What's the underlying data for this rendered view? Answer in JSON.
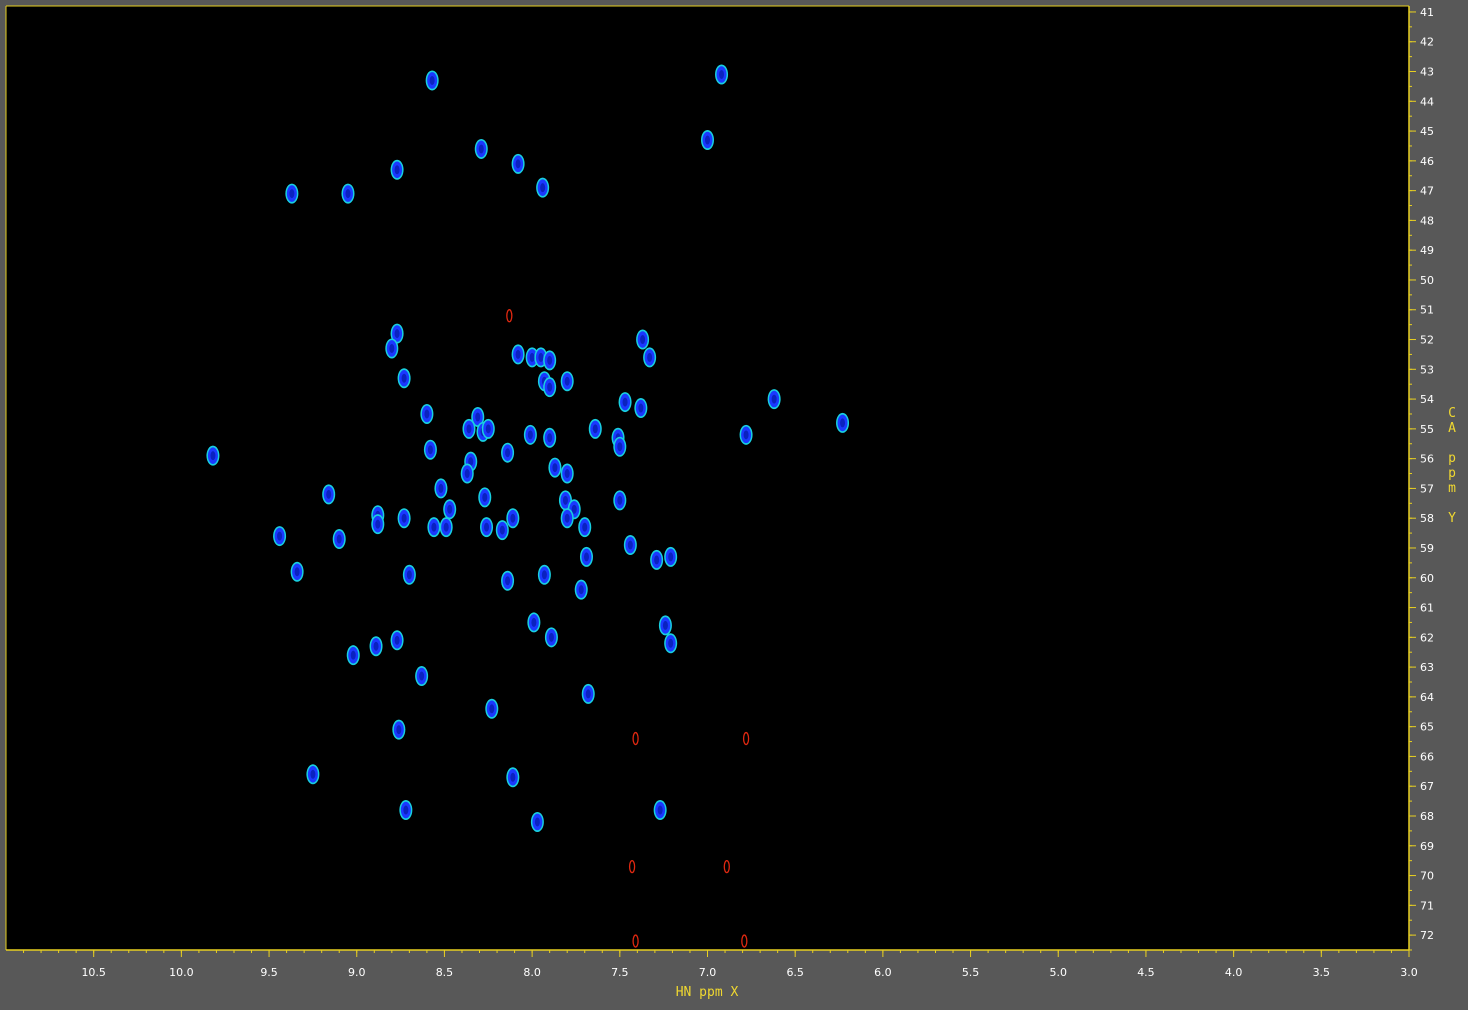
{
  "chart_data": {
    "type": "scatter",
    "subtype": "2D NMR HN-CA correlation spectrum (contour peaks)",
    "xlabel": "HN ppm X",
    "ylabel": "CA ppm Y",
    "x_axis_reversed": true,
    "xlim": [
      11.0,
      3.0
    ],
    "ylim": [
      40.8,
      72.5
    ],
    "x_ticks": [
      10.5,
      10.0,
      9.5,
      9.0,
      8.5,
      8.0,
      7.5,
      7.0,
      6.5,
      6.0,
      5.5,
      5.0,
      4.5,
      4.0,
      3.5,
      3.0
    ],
    "y_ticks": [
      41,
      42,
      43,
      44,
      45,
      46,
      47,
      48,
      49,
      50,
      51,
      52,
      53,
      54,
      55,
      56,
      57,
      58,
      59,
      60,
      61,
      62,
      63,
      64,
      65,
      66,
      67,
      68,
      69,
      70,
      71,
      72
    ],
    "grid": false,
    "colors": {
      "background": "#000000",
      "frame": "#585858",
      "axis": "#e8d020",
      "tick_label": "#ffffff",
      "positive_peak": "#1a38ff",
      "positive_peak_edge": "#18d0e0",
      "negative_peak": "#e02810"
    },
    "series": [
      {
        "sign": "positive",
        "points": [
          [
            8.57,
            43.3
          ],
          [
            6.92,
            43.1
          ],
          [
            8.29,
            45.6
          ],
          [
            7.0,
            45.3
          ],
          [
            8.08,
            46.1
          ],
          [
            8.77,
            46.3
          ],
          [
            7.94,
            46.9
          ],
          [
            9.37,
            47.1
          ],
          [
            9.05,
            47.1
          ],
          [
            8.77,
            51.8
          ],
          [
            7.37,
            52.0
          ],
          [
            8.8,
            52.3
          ],
          [
            8.08,
            52.5
          ],
          [
            8.0,
            52.6
          ],
          [
            7.95,
            52.6
          ],
          [
            7.9,
            52.7
          ],
          [
            7.33,
            52.6
          ],
          [
            8.73,
            53.3
          ],
          [
            7.8,
            53.4
          ],
          [
            7.93,
            53.4
          ],
          [
            7.9,
            53.6
          ],
          [
            6.62,
            54.0
          ],
          [
            7.47,
            54.1
          ],
          [
            7.38,
            54.3
          ],
          [
            8.6,
            54.5
          ],
          [
            6.23,
            54.8
          ],
          [
            8.31,
            54.6
          ],
          [
            8.36,
            55.0
          ],
          [
            8.28,
            55.1
          ],
          [
            8.25,
            55.0
          ],
          [
            7.64,
            55.0
          ],
          [
            6.78,
            55.2
          ],
          [
            8.01,
            55.2
          ],
          [
            7.9,
            55.3
          ],
          [
            7.51,
            55.3
          ],
          [
            7.5,
            55.6
          ],
          [
            9.82,
            55.9
          ],
          [
            8.58,
            55.7
          ],
          [
            8.14,
            55.8
          ],
          [
            8.35,
            56.1
          ],
          [
            8.37,
            56.5
          ],
          [
            7.87,
            56.3
          ],
          [
            7.8,
            56.5
          ],
          [
            7.5,
            57.4
          ],
          [
            8.52,
            57.0
          ],
          [
            9.16,
            57.2
          ],
          [
            8.27,
            57.3
          ],
          [
            7.81,
            57.4
          ],
          [
            8.47,
            57.7
          ],
          [
            7.76,
            57.7
          ],
          [
            7.8,
            58.0
          ],
          [
            8.88,
            57.9
          ],
          [
            8.73,
            58.0
          ],
          [
            8.11,
            58.0
          ],
          [
            8.88,
            58.2
          ],
          [
            8.56,
            58.3
          ],
          [
            8.49,
            58.3
          ],
          [
            8.26,
            58.3
          ],
          [
            7.7,
            58.3
          ],
          [
            8.17,
            58.4
          ],
          [
            9.44,
            58.6
          ],
          [
            9.1,
            58.7
          ],
          [
            7.44,
            58.9
          ],
          [
            7.69,
            59.3
          ],
          [
            7.29,
            59.4
          ],
          [
            7.21,
            59.3
          ],
          [
            9.34,
            59.8
          ],
          [
            8.7,
            59.9
          ],
          [
            7.93,
            59.9
          ],
          [
            8.14,
            60.1
          ],
          [
            7.72,
            60.4
          ],
          [
            7.99,
            61.5
          ],
          [
            7.24,
            61.6
          ],
          [
            7.89,
            62.0
          ],
          [
            8.77,
            62.1
          ],
          [
            7.21,
            62.2
          ],
          [
            8.89,
            62.3
          ],
          [
            9.02,
            62.6
          ],
          [
            8.63,
            63.3
          ],
          [
            7.68,
            63.9
          ],
          [
            8.23,
            64.4
          ],
          [
            8.76,
            65.1
          ],
          [
            9.25,
            66.6
          ],
          [
            8.11,
            66.7
          ],
          [
            7.27,
            67.8
          ],
          [
            8.72,
            67.8
          ],
          [
            7.97,
            68.2
          ]
        ]
      },
      {
        "sign": "negative",
        "points": [
          [
            8.13,
            51.2
          ],
          [
            7.41,
            65.4
          ],
          [
            6.78,
            65.4
          ],
          [
            7.43,
            69.7
          ],
          [
            6.89,
            69.7
          ],
          [
            7.41,
            72.2
          ],
          [
            6.79,
            72.2
          ]
        ]
      }
    ]
  }
}
